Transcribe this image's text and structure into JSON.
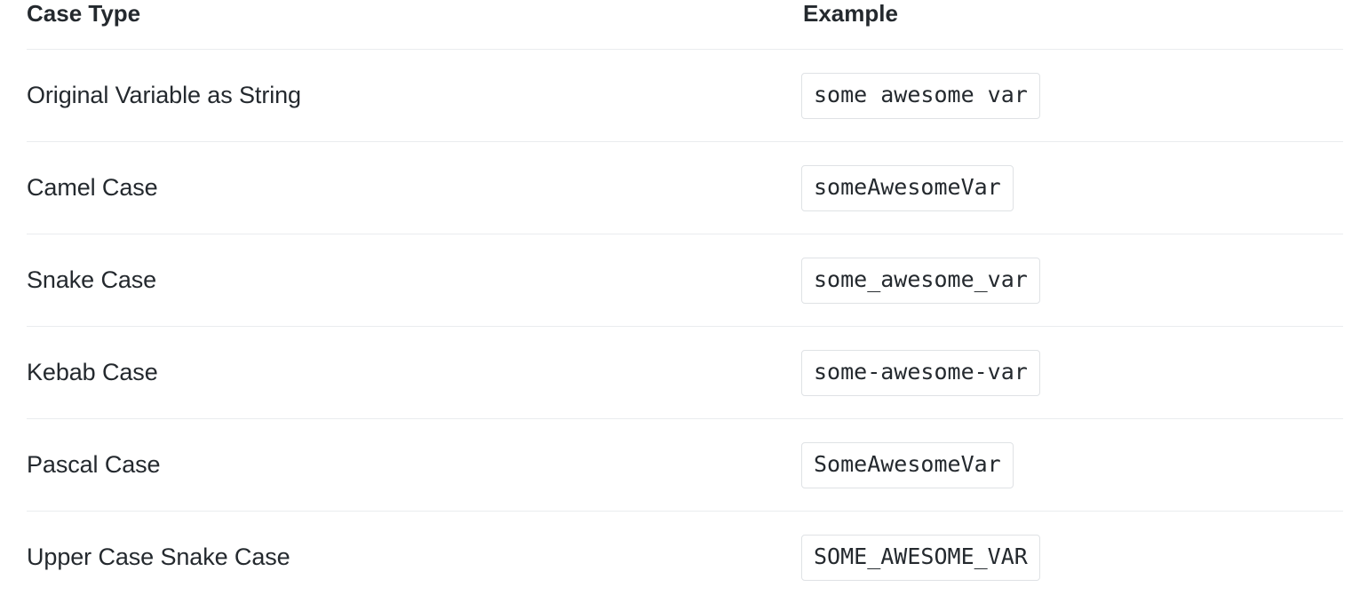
{
  "table": {
    "columns": [
      {
        "key": "case_type",
        "label": "Case Type"
      },
      {
        "key": "example",
        "label": "Example"
      }
    ],
    "rows": [
      {
        "case_type": "Original Variable as String",
        "example": "some awesome var"
      },
      {
        "case_type": "Camel Case",
        "example": "someAwesomeVar"
      },
      {
        "case_type": "Snake Case",
        "example": "some_awesome_var"
      },
      {
        "case_type": "Kebab Case",
        "example": "some-awesome-var"
      },
      {
        "case_type": "Pascal Case",
        "example": "SomeAwesomeVar"
      },
      {
        "case_type": "Upper Case Snake Case",
        "example": "SOME_AWESOME_VAR"
      }
    ]
  },
  "colors": {
    "text": "#24292e",
    "divider": "#eaecef",
    "chip_border": "#dfe2e5",
    "background": "#ffffff"
  }
}
